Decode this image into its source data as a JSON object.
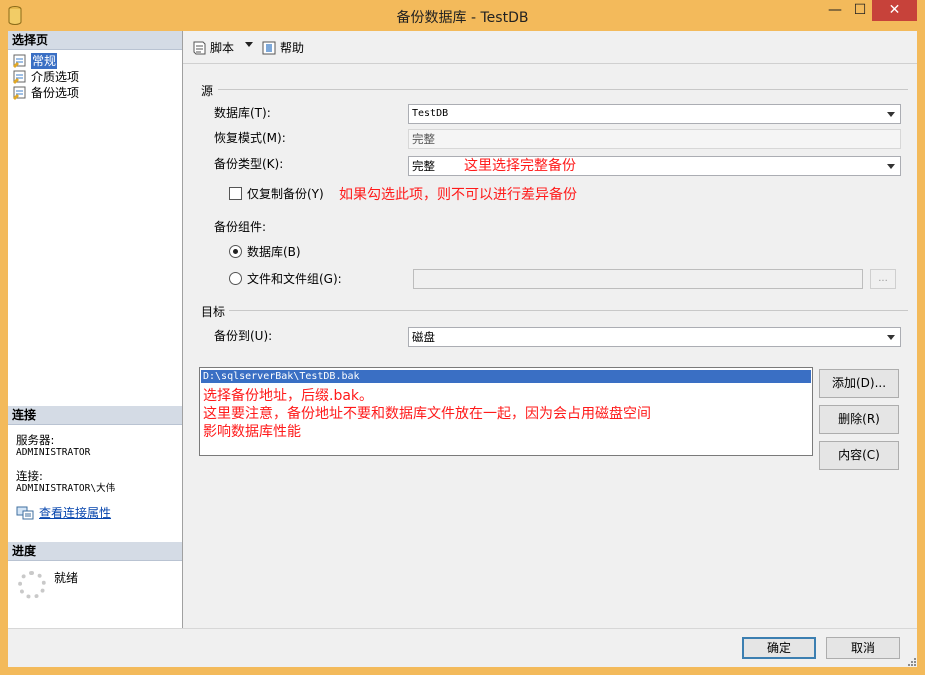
{
  "window": {
    "title": "备份数据库 - TestDB",
    "controls": {
      "minimize": "—",
      "maximize": "☐",
      "close": "✕"
    }
  },
  "left_pane": {
    "select_page_header": "选择页",
    "pages": [
      {
        "label": "常规",
        "selected": true
      },
      {
        "label": "介质选项",
        "selected": false
      },
      {
        "label": "备份选项",
        "selected": false
      }
    ],
    "connection_header": "连接",
    "server_label": "服务器:",
    "server_value": "ADMINISTRATOR",
    "connection_label": "连接:",
    "connection_value": "ADMINISTRATOR\\大伟",
    "view_properties_link": "查看连接属性",
    "progress_header": "进度",
    "progress_status": "就绪"
  },
  "toolbar": {
    "script_label": "脚本",
    "help_label": "帮助"
  },
  "source": {
    "section_title": "源",
    "database_label": "数据库(T):",
    "database_value": "TestDB",
    "recovery_label": "恢复模式(M):",
    "recovery_value": "完整",
    "backup_type_label": "备份类型(K):",
    "backup_type_value": "完整",
    "backup_type_note": "这里选择完整备份",
    "copy_only_label": "仅复制备份(Y)",
    "copy_only_checked": false,
    "copy_only_note": "如果勾选此项，则不可以进行差异备份",
    "component_label": "备份组件:",
    "component_database_label": "数据库(B)",
    "component_files_label": "文件和文件组(G):",
    "ellipsis_label": "..."
  },
  "destination": {
    "section_title": "目标",
    "backup_to_label": "备份到(U):",
    "backup_to_value": "磁盘",
    "list_items": [
      "D:\\sqlserverBak\\TestDB.bak"
    ],
    "notes": [
      "选择备份地址，后缀.bak。",
      "这里要注意，备份地址不要和数据库文件放在一起，因为会占用磁盘空间",
      "影响数据库性能"
    ],
    "add_button": "添加(D)...",
    "remove_button": "删除(R)",
    "contents_button": "内容(C)"
  },
  "footer": {
    "ok_label": "确定",
    "cancel_label": "取消"
  },
  "colors": {
    "titlebar": "#f3ba5b",
    "close_button": "#c7423a",
    "selection": "#3a6fc4",
    "annotation_red": "#ff1a1a",
    "link_blue": "#0645ad"
  }
}
